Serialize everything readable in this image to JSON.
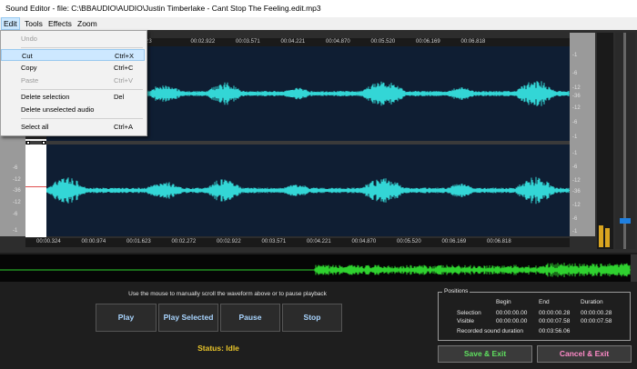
{
  "window": {
    "title": "Sound Editor - file: C:\\BBAUDIO\\AUDIO\\Justin Timberlake - Cant Stop The Feeling.edit.mp3"
  },
  "menubar": {
    "edit": "Edit",
    "tools": "Tools",
    "effects": "Effects",
    "zoom": "Zoom"
  },
  "edit_menu": {
    "undo": "Undo",
    "cut": "Cut",
    "cut_shortcut": "Ctrl+X",
    "copy": "Copy",
    "copy_shortcut": "Ctrl+C",
    "paste": "Paste",
    "paste_shortcut": "Ctrl+V",
    "delete_selection": "Delete selection",
    "delete_selection_shortcut": "Del",
    "delete_unselected": "Delete unselected audio",
    "select_all": "Select all",
    "select_all_shortcut": "Ctrl+A"
  },
  "top_time_labels": [
    "23",
    "00:02.922",
    "00:03.571",
    "00:04.221",
    "00:04.870",
    "00:05.520",
    "00:06.169",
    "00:06.818"
  ],
  "bottom_time_labels": [
    "00:00.324",
    "00:00.974",
    "00:01.623",
    "00:02.272",
    "00:02.922",
    "00:03.571",
    "00:04.221",
    "00:04.870",
    "00:05.520",
    "00:06.169",
    "00:06.818"
  ],
  "scale_labels_top": [
    "-1",
    "-6",
    "-12",
    "-36",
    "-12",
    "-6",
    "-1"
  ],
  "scale_labels_bottom": [
    "-1",
    "-6",
    "-12",
    "-36",
    "-12",
    "-6",
    "-1"
  ],
  "left_scale_labels": [
    "-6",
    "-12",
    "-36",
    "-12",
    "-6",
    "-1"
  ],
  "instructions": "Use the mouse to manually scroll the waveform above or to pause playback",
  "buttons": {
    "play": "Play",
    "play_selected": "Play Selected",
    "pause": "Pause",
    "stop": "Stop",
    "save_exit": "Save & Exit",
    "cancel_exit": "Cancel & Exit"
  },
  "status": "Status: Idle",
  "positions": {
    "legend": "Positions",
    "headers": {
      "begin": "Begin",
      "end": "End",
      "duration": "Duration"
    },
    "selection": {
      "label": "Selection",
      "begin": "00:00:00.00",
      "end": "00:00:00.28",
      "duration": "00:00:00.28"
    },
    "visible": {
      "label": "Visible",
      "begin": "00:00:00.00",
      "end": "00:00:07.58",
      "duration": "00:00:07.58"
    },
    "recorded": {
      "label": "Recorded sound duration",
      "value": "00:03:56.06"
    }
  },
  "colors": {
    "waveform": "#33d6d6",
    "overview": "#2fd12f",
    "meter": "#d9a520",
    "slider": "#1e7fe0"
  }
}
